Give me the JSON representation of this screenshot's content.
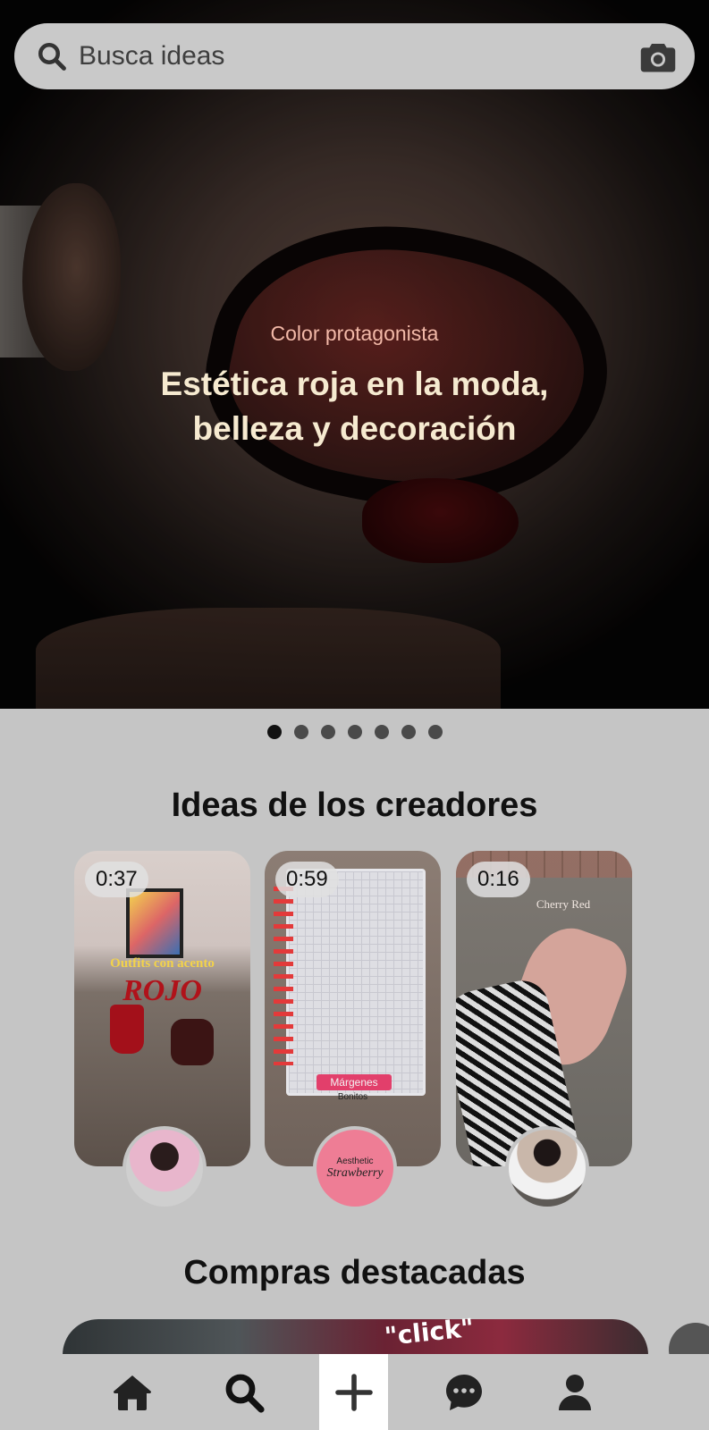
{
  "search": {
    "placeholder": "Busca ideas"
  },
  "hero": {
    "subtitle": "Color protagonista",
    "title_line1": "Estética roja en la moda,",
    "title_line2": "belleza y decoración",
    "carousel_pages": 7,
    "carousel_active": 1
  },
  "creators": {
    "title": "Ideas de los creadores",
    "cards": [
      {
        "duration": "0:37",
        "overlay_line1": "Outfits con acento",
        "overlay_line2": "ROJO"
      },
      {
        "duration": "0:59",
        "overlay_line1": "Márgenes",
        "overlay_line2": "Bonitos",
        "avatar_text1": "Aesthetic",
        "avatar_text2": "Strawberry"
      },
      {
        "duration": "0:16",
        "overlay_line1": "Cherry Red"
      }
    ]
  },
  "shopping": {
    "title": "Compras destacadas",
    "doodle": "\"click\""
  },
  "nav": {
    "icons": [
      "home-icon",
      "search-icon",
      "plus-icon",
      "chat-icon",
      "profile-icon"
    ]
  },
  "colors": {
    "background": "#c5c5c5",
    "hero_title": "#f6ead0",
    "hero_subtitle": "#f2b9a8"
  }
}
